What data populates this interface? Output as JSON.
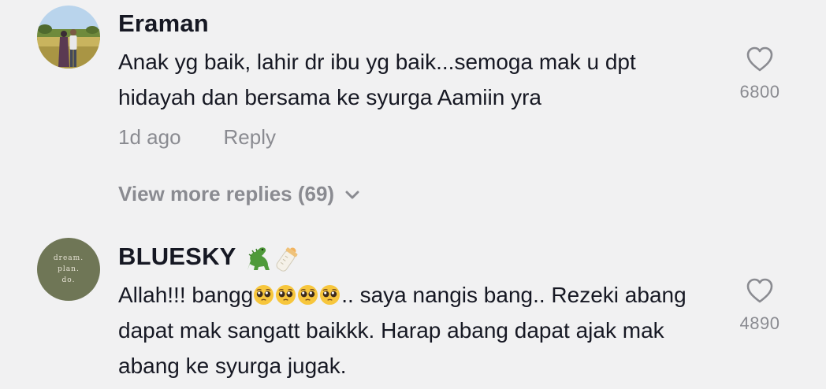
{
  "comments": [
    {
      "username": "Eraman",
      "text": "Anak yg baik, lahir dr ibu yg baik...semoga mak u dpt hidayah dan bersama ke syurga Aamiin yra",
      "time_ago": "1d ago",
      "reply_label": "Reply",
      "view_more_label": "View more replies (69)",
      "like_count": "6800"
    },
    {
      "username": "BLUESKY",
      "username_emojis": [
        "dinosaur-icon",
        "baby-bottle-icon"
      ],
      "text_before_emoji": "Allah!!! bangg",
      "text_after_emoji": ".. saya nangis bang.. Rezeki abang dapat mak sangatt baikkk. Harap abang dapat ajak mak abang ke syurga jugak.",
      "emoji_sequence": [
        "pleading-face-icon",
        "pleading-face-icon",
        "pleading-face-icon",
        "pleading-face-icon"
      ],
      "avatar_text": [
        "dream.",
        "plan.",
        "do."
      ],
      "like_count": "4890"
    }
  ],
  "colors": {
    "background": "#f1f1f2",
    "primary_text": "#161823",
    "secondary_text": "#8a8b91",
    "avatar_green": "#6f7656"
  }
}
